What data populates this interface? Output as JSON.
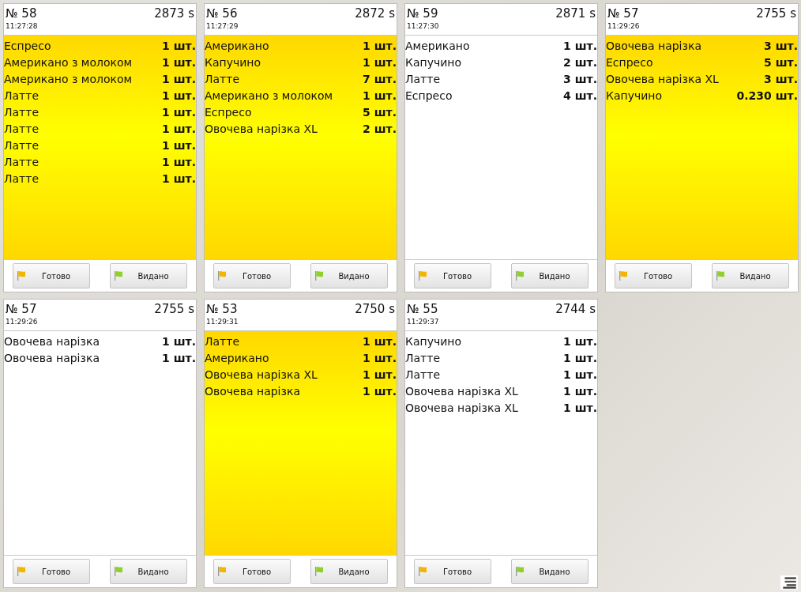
{
  "orders": [
    {
      "number": "№ 58",
      "elapsed": "2873 s",
      "time": "11:27:28",
      "highlighted": true,
      "items": [
        {
          "name": "Еспресо",
          "qty": "1 шт."
        },
        {
          "name": "Американо з молоком",
          "qty": "1 шт."
        },
        {
          "name": "Американо з молоком",
          "qty": "1 шт."
        },
        {
          "name": "Латте",
          "qty": "1 шт."
        },
        {
          "name": "Латте",
          "qty": "1 шт."
        },
        {
          "name": "Латте",
          "qty": "1 шт."
        },
        {
          "name": "Латте",
          "qty": "1 шт."
        },
        {
          "name": "Латте",
          "qty": "1 шт."
        },
        {
          "name": "Латте",
          "qty": "1 шт."
        }
      ],
      "buttons": [
        "Готово",
        "Видано"
      ]
    },
    {
      "number": "№ 56",
      "elapsed": "2872 s",
      "time": "11:27:29",
      "highlighted": true,
      "items": [
        {
          "name": "Американо",
          "qty": "1 шт."
        },
        {
          "name": "Капучино",
          "qty": "1 шт."
        },
        {
          "name": "Латте",
          "qty": "7 шт."
        },
        {
          "name": "Американо з молоком",
          "qty": "1 шт."
        },
        {
          "name": "Еспресо",
          "qty": "5 шт."
        },
        {
          "name": "Овочева нарізка XL",
          "qty": "2 шт."
        }
      ],
      "buttons": [
        "Готово",
        "Видано"
      ]
    },
    {
      "number": "№ 59",
      "elapsed": "2871 s",
      "time": "11:27:30",
      "highlighted": false,
      "items": [
        {
          "name": "Американо",
          "qty": "1 шт."
        },
        {
          "name": "Капучино",
          "qty": "2 шт."
        },
        {
          "name": "Латте",
          "qty": "3 шт."
        },
        {
          "name": "Еспресо",
          "qty": "4 шт."
        }
      ],
      "buttons": [
        "Готово",
        "Видано"
      ]
    },
    {
      "number": "№ 57",
      "elapsed": "2755 s",
      "time": "11:29:26",
      "highlighted": true,
      "items": [
        {
          "name": "Овочева нарізка",
          "qty": "3 шт."
        },
        {
          "name": "Еспресо",
          "qty": "5 шт."
        },
        {
          "name": "Овочева нарізка XL",
          "qty": "3 шт."
        },
        {
          "name": "Капучино",
          "qty": "0.230 шт."
        }
      ],
      "buttons": [
        "Готово",
        "Видано"
      ]
    },
    {
      "number": "№ 57",
      "elapsed": "2755 s",
      "time": "11:29:26",
      "highlighted": false,
      "items": [
        {
          "name": "Овочева нарізка",
          "qty": "1 шт."
        },
        {
          "name": "Овочева нарізка",
          "qty": "1 шт."
        }
      ],
      "buttons": [
        "Готово",
        "Видано"
      ]
    },
    {
      "number": "№ 53",
      "elapsed": "2750 s",
      "time": "11:29:31",
      "highlighted": true,
      "items": [
        {
          "name": "Латте",
          "qty": "1 шт."
        },
        {
          "name": "Американо",
          "qty": "1 шт."
        },
        {
          "name": "Овочева нарізка XL",
          "qty": "1 шт."
        },
        {
          "name": "Овочева нарізка",
          "qty": "1 шт."
        }
      ],
      "buttons": [
        "Готово",
        "Видано"
      ]
    },
    {
      "number": "№ 55",
      "elapsed": "2744 s",
      "time": "11:29:37",
      "highlighted": false,
      "items": [
        {
          "name": "Капучино",
          "qty": "1 шт."
        },
        {
          "name": "Латте",
          "qty": "1 шт."
        },
        {
          "name": "Латте",
          "qty": "1 шт."
        },
        {
          "name": "Овочева нарізка XL",
          "qty": "1 шт."
        },
        {
          "name": "Овочева нарізка XL",
          "qty": "1 шт."
        }
      ],
      "buttons": [
        "Готово",
        "Видано"
      ]
    }
  ]
}
